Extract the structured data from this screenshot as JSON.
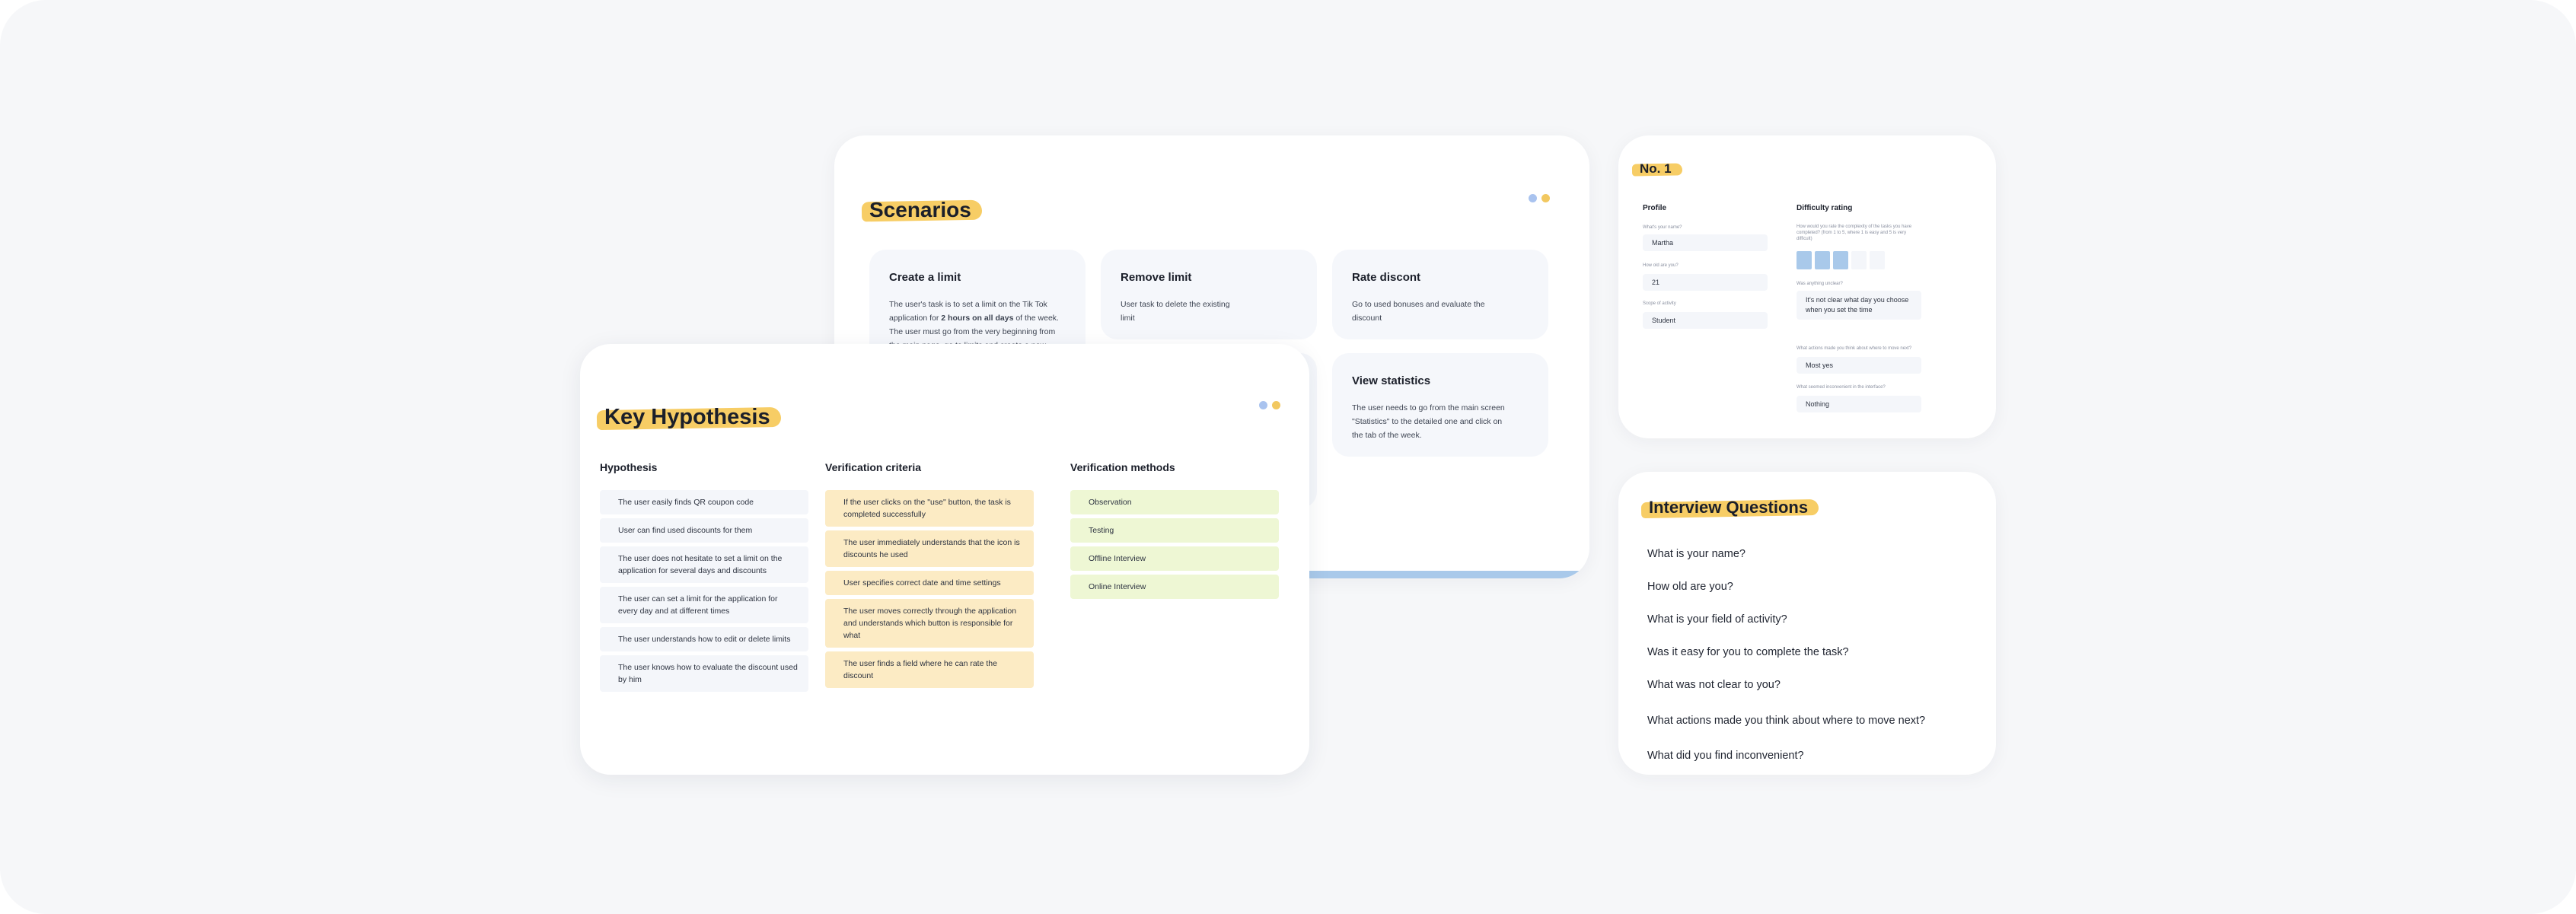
{
  "scenarios": {
    "title": "Scenarios",
    "cards": [
      {
        "title": "Create a limit",
        "text_before": "The user's task is to set a limit on the Tik Tok application for ",
        "text_bold": "2 hours on all days",
        "text_after": " of the week. The user must go from the very beginning from the main page, go to limits and create a new"
      },
      {
        "title": "Remove limit",
        "text": "User task to delete the existing limit"
      },
      {
        "title": "Rate discont",
        "text": "Go to used bonuses and evaluate the discount"
      },
      {
        "title": "View statistics",
        "text": "The user needs to go from the main screen \"Statistics\" to the detailed one and click on the tab of the week."
      }
    ]
  },
  "hypothesis": {
    "title": "Key Hypothesis",
    "columns": {
      "hypothesis": "Hypothesis",
      "criteria": "Verification criteria",
      "methods": "Verification methods"
    },
    "hypothesis_items": [
      "The user easily finds QR coupon code",
      "User can find used discounts for them",
      "The user does not hesitate to set a limit on the application for several days and discounts",
      "The user can set a limit for the application for every day and at different times",
      "The user understands how to edit or delete limits",
      "The user knows how to evaluate the discount used by him"
    ],
    "criteria_items": [
      "If the user clicks on the \"use\" button, the task is completed successfully",
      "The user immediately understands that the icon is discounts he used",
      "User specifies correct date and time settings",
      "The user moves correctly through the application and understands which button is responsible for what",
      "The user finds a field where he can rate the discount"
    ],
    "method_items": [
      "Observation",
      "Testing",
      "Offline Interview",
      "Online Interview"
    ]
  },
  "respondent": {
    "title": "No. 1",
    "profile_title": "Profile",
    "name_label": "What's your name?",
    "name_value": "Martha",
    "age_label": "How old are you?",
    "age_value": "21",
    "activity_label": "Scope of activity",
    "activity_value": "Student",
    "difficulty_title": "Difficulty rating",
    "difficulty_question": "How would you rate the complexity of the tasks you have completed? (from 1 to 5, where 1 is easy and 5 is very difficult)",
    "rating": 3,
    "rating_max": 5,
    "unclear_label": "Was anything unclear?",
    "unclear_value": "It's not clear what day you choose when you set the time",
    "actions_label": "What actions made you think about where to move next?",
    "actions_value": "Most yes",
    "inconvenient_label": "What seemed inconvenient in the interface?",
    "inconvenient_value": "Nothing"
  },
  "interview": {
    "title": "Interview Questions",
    "questions": [
      "What is your name?",
      "How old are you?",
      "What is your field of activity?",
      "Was it easy for you to complete the task?",
      "What was not clear to you?",
      "What actions made you think about where to move next?",
      "What did you find inconvenient?"
    ]
  },
  "colors": {
    "highlight": "#f7cd65",
    "dot_blue": "#a9c3ef",
    "dot_yellow": "#f2c860",
    "accent_bar": "#a9c9ea"
  }
}
